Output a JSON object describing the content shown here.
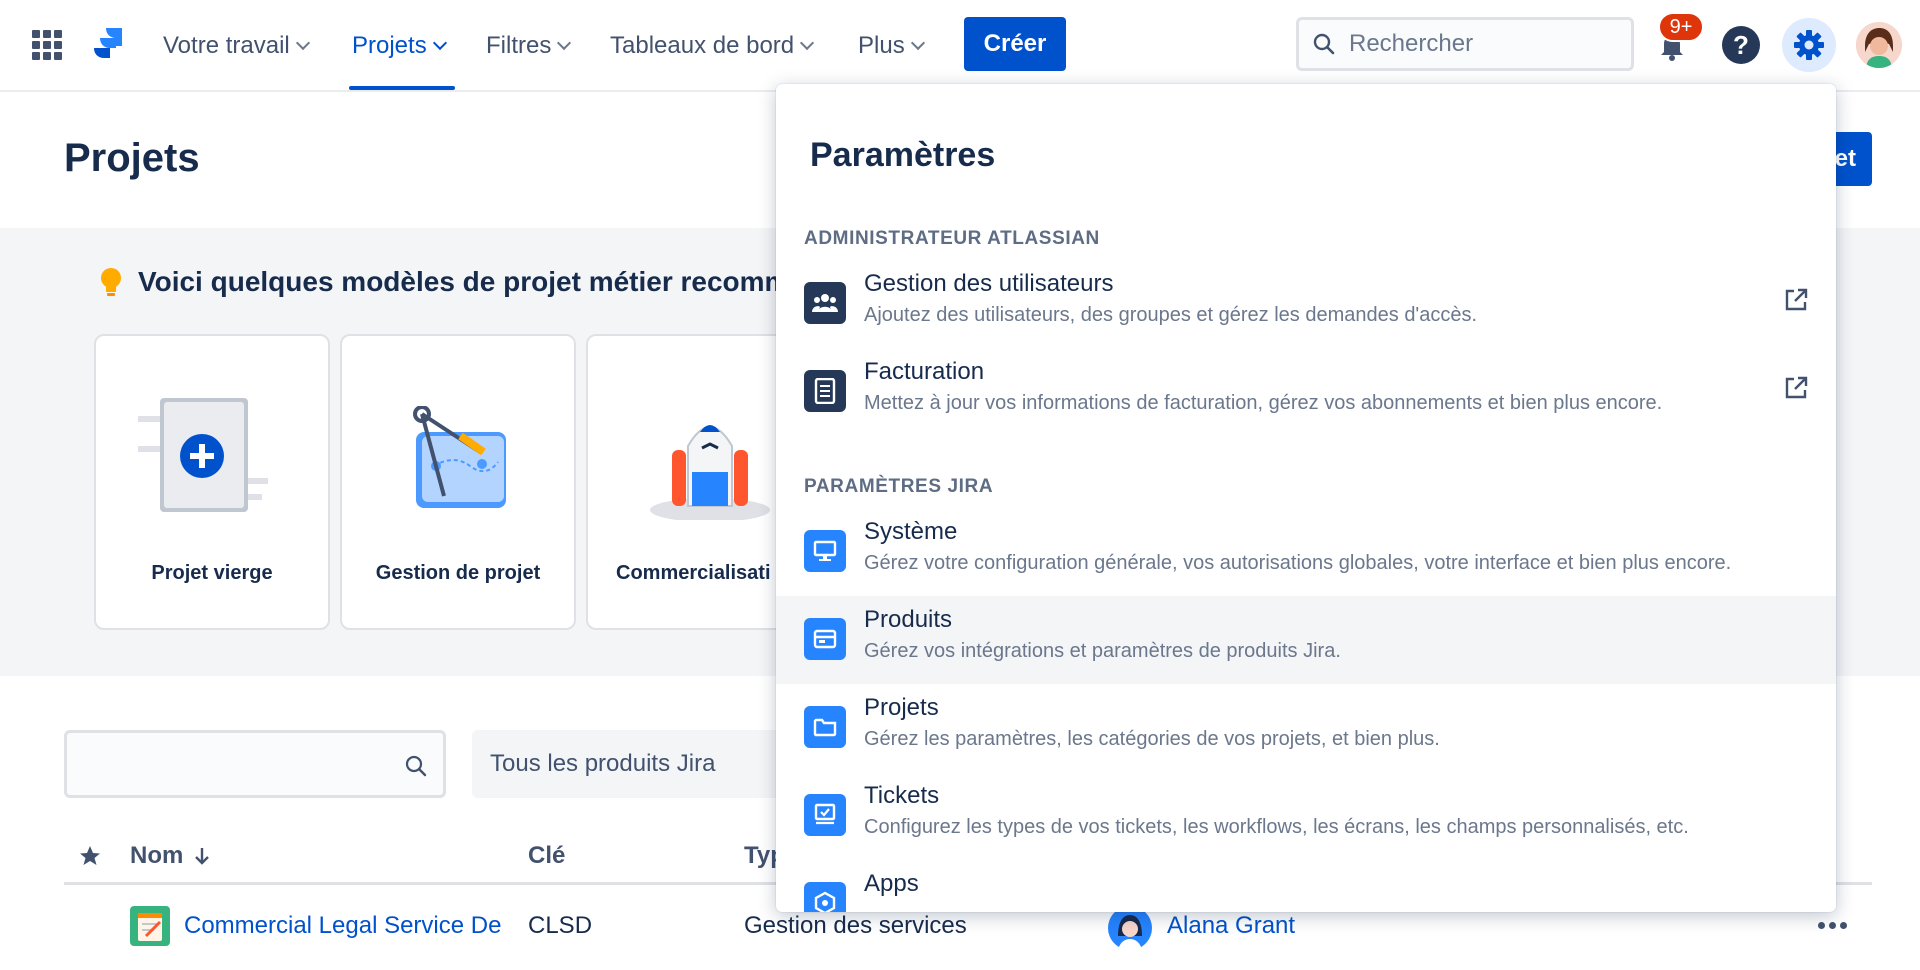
{
  "nav": {
    "items": [
      {
        "label": "Votre travail"
      },
      {
        "label": "Projets"
      },
      {
        "label": "Filtres"
      },
      {
        "label": "Tableaux de bord"
      },
      {
        "label": "Plus"
      }
    ],
    "create_label": "Créer",
    "search_placeholder": "Rechercher",
    "notifications_badge": "9+",
    "help_glyph": "?"
  },
  "page": {
    "title": "Projets",
    "create_project_label_partial": "et"
  },
  "templates": {
    "heading": "Voici quelques modèles de projet métier recommar",
    "cards": [
      {
        "label": "Projet vierge",
        "icon": "blank-project-icon"
      },
      {
        "label": "Gestion de projet",
        "icon": "compass-map-icon"
      },
      {
        "label": "Commercialisati",
        "icon": "rocket-icon"
      }
    ]
  },
  "filters": {
    "search_value": "",
    "product_select_value": "Tous les produits Jira"
  },
  "table": {
    "headers": {
      "name": "Nom",
      "key": "Clé",
      "type": "Typ"
    },
    "rows": [
      {
        "name": "Commercial Legal Service De",
        "key": "CLSD",
        "type": "Gestion des services",
        "lead": "Alana Grant"
      }
    ]
  },
  "dropdown": {
    "title": "Paramètres",
    "sections": [
      {
        "heading": "ADMINISTRATEUR ATLASSIAN",
        "items": [
          {
            "name": "Gestion des utilisateurs",
            "desc": "Ajoutez des utilisateurs, des groupes et gérez les demandes d'accès.",
            "icon": "users-icon",
            "external": true
          },
          {
            "name": "Facturation",
            "desc": "Mettez à jour vos informations de facturation, gérez vos abonnements et bien plus encore.",
            "icon": "billing-icon",
            "external": true
          }
        ]
      },
      {
        "heading": "PARAMÈTRES JIRA",
        "items": [
          {
            "name": "Système",
            "desc": "Gérez votre configuration générale, vos autorisations globales, votre interface et bien plus encore.",
            "icon": "monitor-icon"
          },
          {
            "name": "Produits",
            "desc": "Gérez vos intégrations et paramètres de produits Jira.",
            "icon": "products-icon"
          },
          {
            "name": "Projets",
            "desc": "Gérez les paramètres, les catégories de vos projets, et bien plus.",
            "icon": "folder-icon"
          },
          {
            "name": "Tickets",
            "desc": "Configurez les types de vos tickets, les workflows, les écrans, les champs personnalisés, etc.",
            "icon": "tickets-icon"
          },
          {
            "name": "Apps",
            "desc": "",
            "icon": "apps-icon"
          }
        ]
      }
    ]
  },
  "colors": {
    "brand_blue": "#0052cc",
    "icon_blue": "#2684ff",
    "icon_dark": "#253858",
    "badge_red": "#de350b",
    "text_primary": "#172b4d",
    "text_secondary": "#6b778c"
  }
}
